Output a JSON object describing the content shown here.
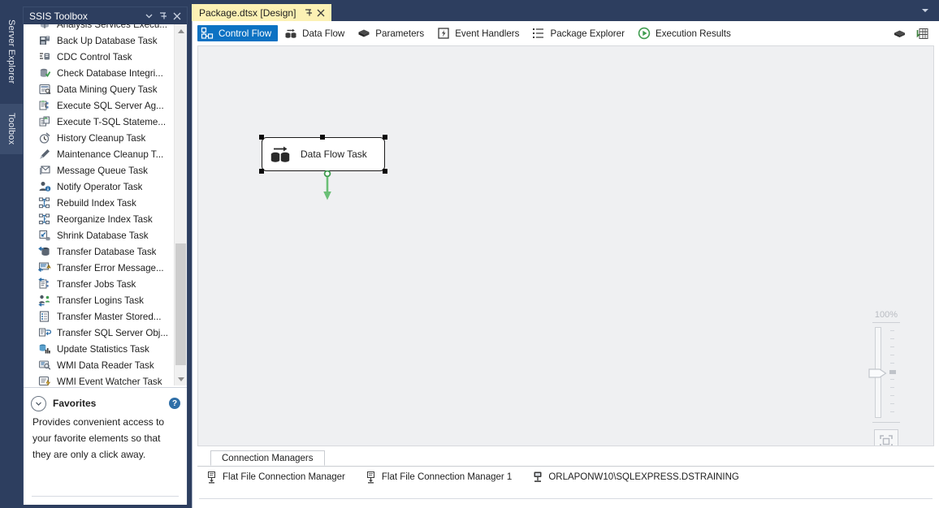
{
  "vertical_tabs": [
    {
      "label": "Server Explorer",
      "name": "vtab-server-explorer"
    },
    {
      "label": "Toolbox",
      "name": "vtab-toolbox"
    }
  ],
  "toolbox": {
    "title": "SSIS Toolbox",
    "header_buttons": [
      {
        "name": "toolbox-dropdown-button",
        "icon": "chevron-down-icon"
      },
      {
        "name": "toolbox-pin-button",
        "icon": "pin-icon"
      },
      {
        "name": "toolbox-close-button",
        "icon": "close-icon"
      }
    ],
    "items": [
      {
        "label": "Analysis Services Execu...",
        "icon": "analysis-services-icon"
      },
      {
        "label": "Back Up Database Task",
        "icon": "backup-database-icon"
      },
      {
        "label": "CDC Control Task",
        "icon": "cdc-control-icon"
      },
      {
        "label": "Check Database Integri...",
        "icon": "check-database-integrity-icon"
      },
      {
        "label": "Data Mining Query Task",
        "icon": "data-mining-query-icon"
      },
      {
        "label": "Execute SQL Server Ag...",
        "icon": "execute-sql-agent-icon"
      },
      {
        "label": "Execute T-SQL Stateme...",
        "icon": "execute-tsql-icon"
      },
      {
        "label": "History Cleanup Task",
        "icon": "history-cleanup-icon"
      },
      {
        "label": "Maintenance Cleanup T...",
        "icon": "maintenance-cleanup-icon"
      },
      {
        "label": "Message Queue Task",
        "icon": "message-queue-icon"
      },
      {
        "label": "Notify Operator Task",
        "icon": "notify-operator-icon"
      },
      {
        "label": "Rebuild Index Task",
        "icon": "rebuild-index-icon"
      },
      {
        "label": "Reorganize Index Task",
        "icon": "reorganize-index-icon"
      },
      {
        "label": "Shrink Database Task",
        "icon": "shrink-database-icon"
      },
      {
        "label": "Transfer Database Task",
        "icon": "transfer-database-icon"
      },
      {
        "label": "Transfer Error Message...",
        "icon": "transfer-error-message-icon"
      },
      {
        "label": "Transfer Jobs Task",
        "icon": "transfer-jobs-icon"
      },
      {
        "label": "Transfer Logins Task",
        "icon": "transfer-logins-icon"
      },
      {
        "label": "Transfer Master Stored...",
        "icon": "transfer-master-stored-icon"
      },
      {
        "label": "Transfer SQL Server Obj...",
        "icon": "transfer-sql-objects-icon"
      },
      {
        "label": "Update Statistics Task",
        "icon": "update-statistics-icon"
      },
      {
        "label": "WMI Data Reader Task",
        "icon": "wmi-data-reader-icon"
      },
      {
        "label": "WMI Event Watcher Task",
        "icon": "wmi-event-watcher-icon"
      }
    ],
    "favorites": {
      "title": "Favorites",
      "description": "Provides convenient access to your favorite elements so that they are only a click away.",
      "help_label": "?"
    }
  },
  "document": {
    "tab_label": "Package.dtsx [Design]",
    "tab_pin": "pin-icon",
    "tab_close": "close-icon",
    "window_chevron": "chevron-down-icon"
  },
  "designer": {
    "tabs": [
      {
        "label": "Control Flow",
        "icon": "control-flow-icon",
        "active": true
      },
      {
        "label": "Data Flow",
        "icon": "data-flow-icon",
        "active": false
      },
      {
        "label": "Parameters",
        "icon": "parameters-icon",
        "active": false
      },
      {
        "label": "Event Handlers",
        "icon": "event-handlers-icon",
        "active": false
      },
      {
        "label": "Package Explorer",
        "icon": "package-explorer-icon",
        "active": false
      },
      {
        "label": "Execution Results",
        "icon": "execution-results-icon",
        "active": false
      }
    ],
    "right_buttons": [
      {
        "name": "parameters-button",
        "icon": "parameters-icon"
      },
      {
        "name": "variables-button",
        "icon": "variables-grid-icon"
      }
    ]
  },
  "canvas": {
    "task": {
      "label": "Data Flow Task",
      "icon": "data-flow-task-icon",
      "selected": true
    },
    "connector": {
      "icon": "precedence-constraint-arrow",
      "color": "#6abf76"
    },
    "zoom": {
      "percent_label": "100%",
      "fit_button": "fit-to-window-icon"
    }
  },
  "connection_managers": {
    "tab_label": "Connection Managers",
    "items": [
      {
        "label": "Flat File Connection Manager",
        "icon": "flat-file-connection-icon"
      },
      {
        "label": "Flat File Connection Manager 1",
        "icon": "flat-file-connection-icon"
      },
      {
        "label": "ORLAPONW10\\SQLEXPRESS.DSTRAINING",
        "icon": "ole-db-connection-icon"
      }
    ]
  },
  "colors": {
    "chrome_dark": "#2d3e5f",
    "tab_active_yellow": "#fcf1b4",
    "accent_blue": "#0c72c3",
    "canvas_bg": "#eff0f2",
    "arrow_green": "#6abf76"
  }
}
